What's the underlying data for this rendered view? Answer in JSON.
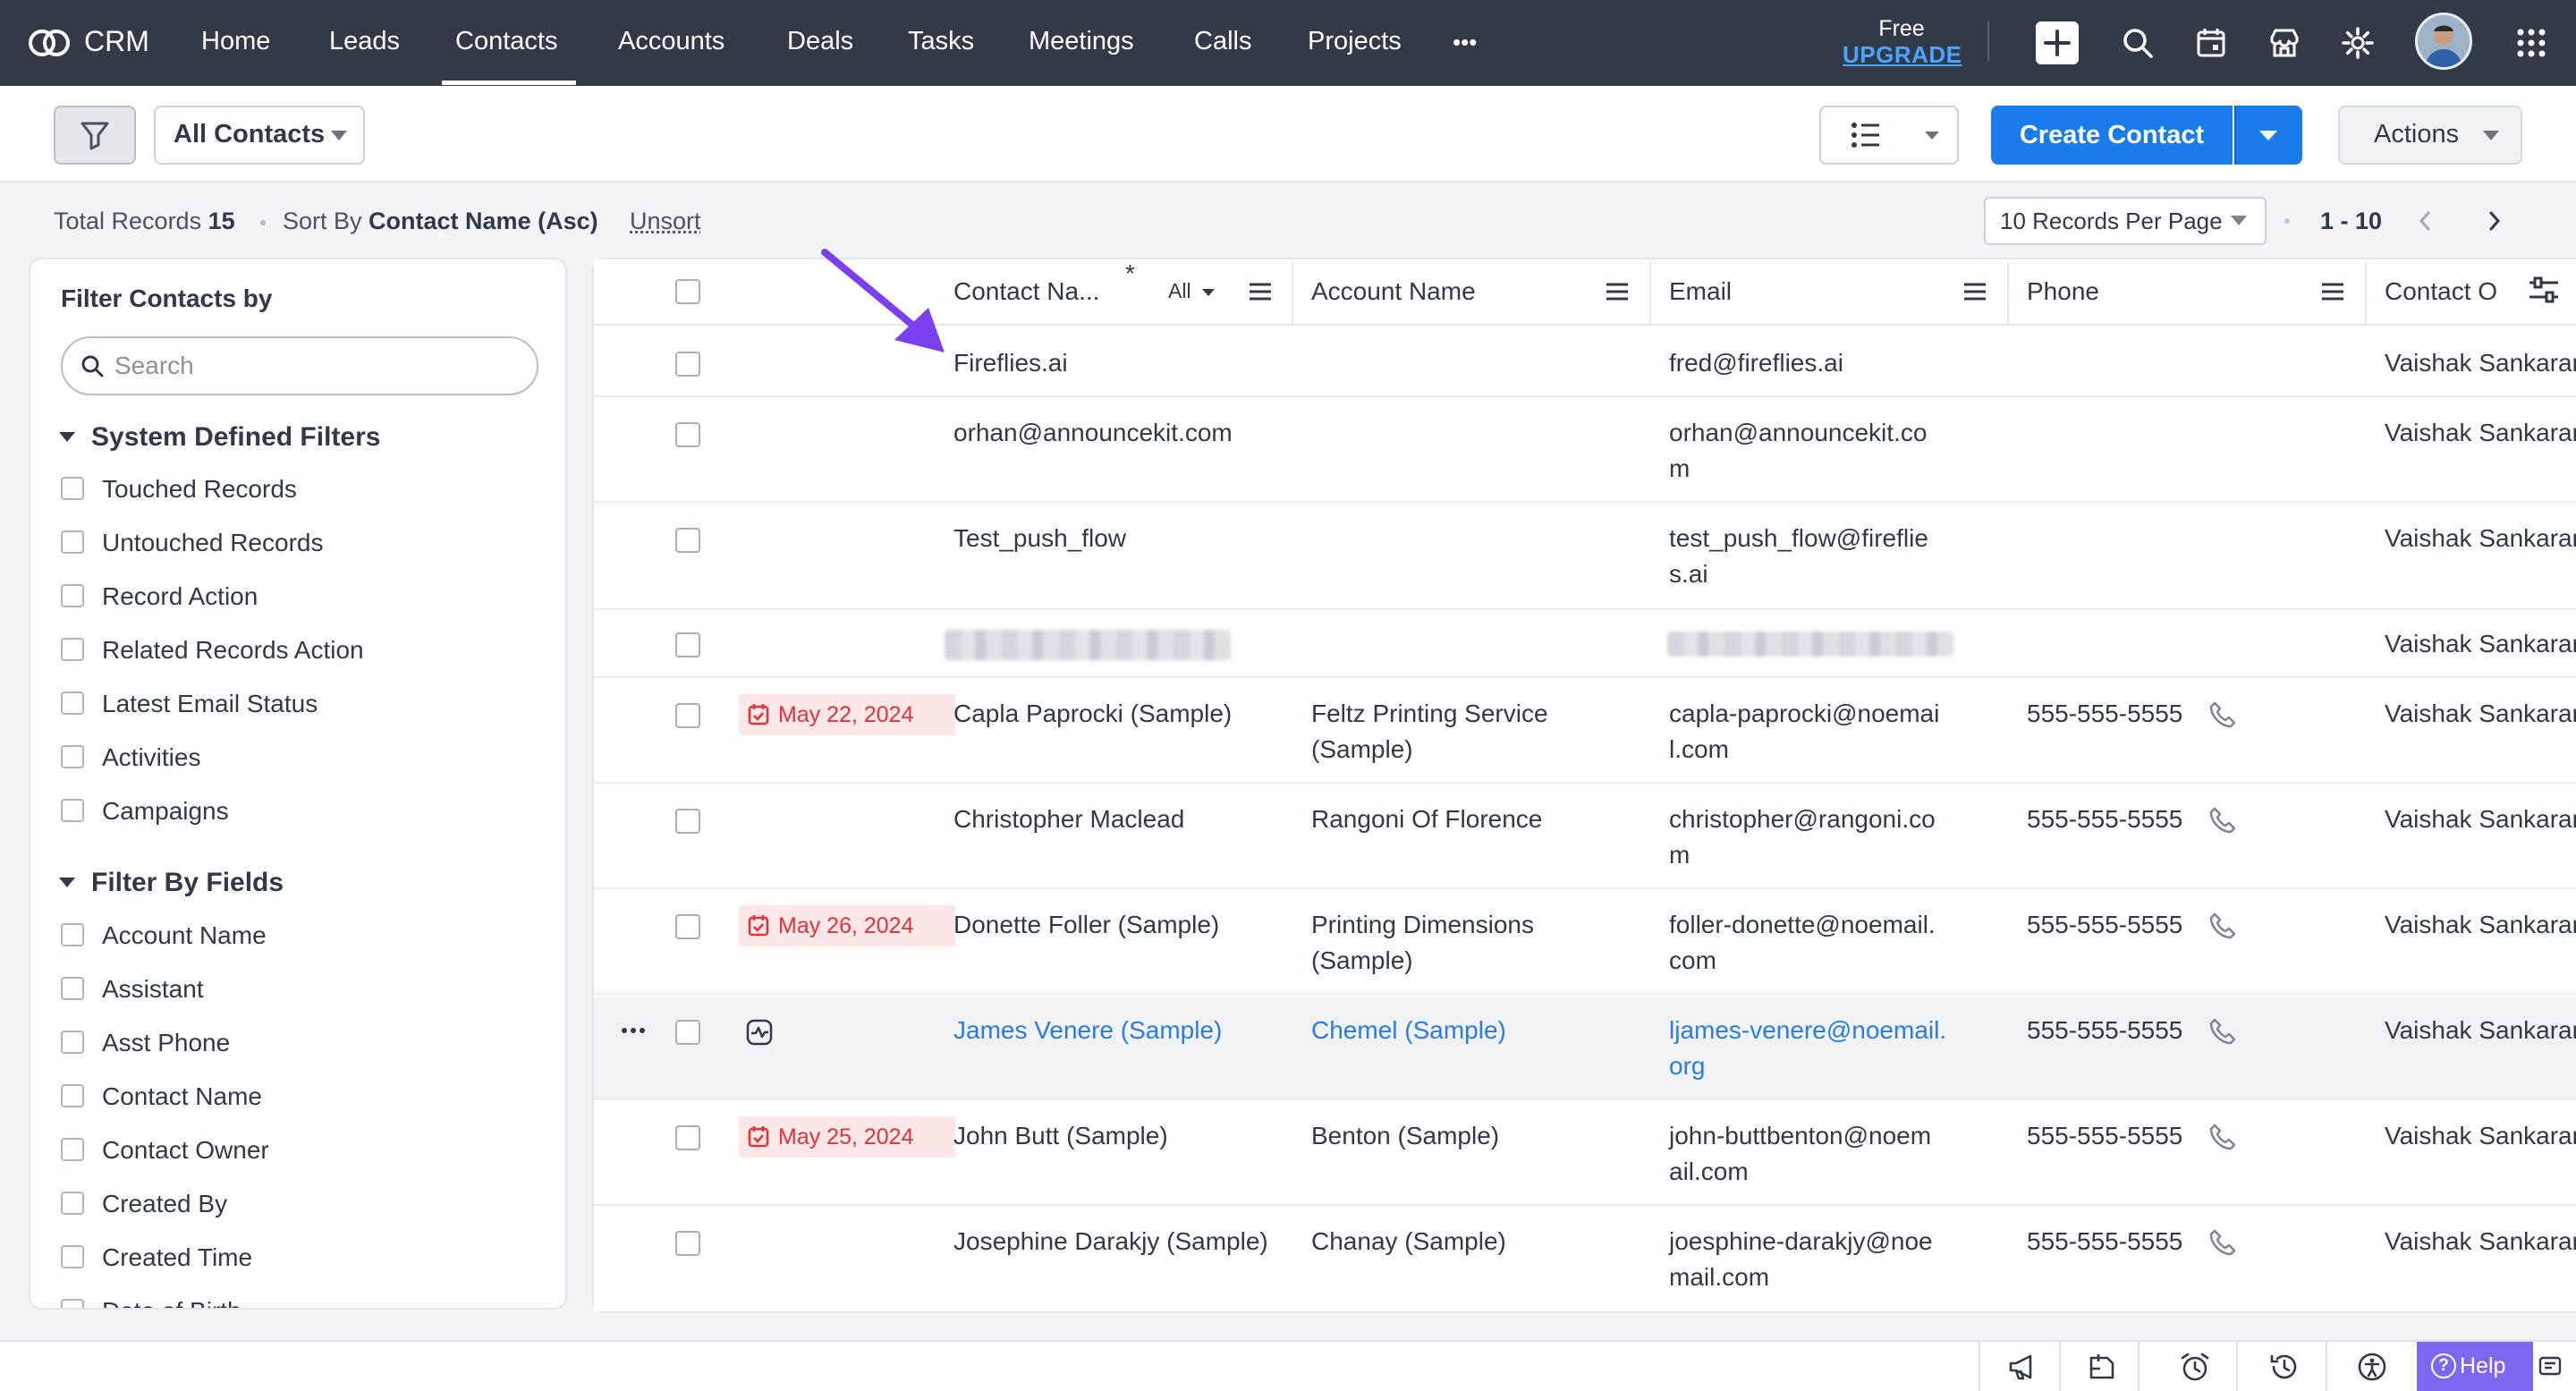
{
  "nav": {
    "app_name": "CRM",
    "items": [
      "Home",
      "Leads",
      "Contacts",
      "Accounts",
      "Deals",
      "Tasks",
      "Meetings",
      "Calls",
      "Projects"
    ],
    "active": "Contacts",
    "more": "•••",
    "free_label": "Free",
    "upgrade_label": "UPGRADE"
  },
  "toolbar": {
    "view_label": "All Contacts",
    "create_label": "Create Contact",
    "actions_label": "Actions"
  },
  "records": {
    "total_label": "Total Records",
    "total_value": "15",
    "sort_label": "Sort By",
    "sort_value": "Contact Name (Asc)",
    "unsort_label": "Unsort",
    "per_page": "10 Records Per Page",
    "range": "1 - 10"
  },
  "filters": {
    "title": "Filter Contacts by",
    "search_placeholder": "Search",
    "system_title": "System Defined Filters",
    "system_items": [
      "Touched Records",
      "Untouched Records",
      "Record Action",
      "Related Records Action",
      "Latest Email Status",
      "Activities",
      "Campaigns"
    ],
    "fields_title": "Filter By Fields",
    "field_items": [
      "Account Name",
      "Assistant",
      "Asst Phone",
      "Contact Name",
      "Contact Owner",
      "Created By",
      "Created Time",
      "Date of Birth"
    ]
  },
  "table": {
    "columns": {
      "contact_name": "Contact Na...",
      "required_mark": "*",
      "all_filter": "All",
      "account_name": "Account Name",
      "email": "Email",
      "phone": "Phone",
      "owner": "Contact O"
    },
    "rows": [
      {
        "date": "",
        "name": "Fireflies.ai",
        "account": "",
        "email": "fred@fireflies.ai",
        "phone": "",
        "owner": "Vaishak Sankaran"
      },
      {
        "date": "",
        "name": "orhan@announcekit.com",
        "account": "",
        "email": "orhan@announcekit.co\nm",
        "phone": "",
        "owner": "Vaishak Sankaran"
      },
      {
        "date": "",
        "name": "Test_push_flow",
        "account": "",
        "email": "test_push_flow@fireflie\ns.ai",
        "phone": "",
        "owner": "Vaishak Sankaran"
      },
      {
        "date": "",
        "name": "",
        "account": "",
        "email": "",
        "phone": "",
        "owner": "Vaishak Sankaran"
      },
      {
        "date": "May 22, 2024",
        "name": "Capla Paprocki (Sample)",
        "account": "Feltz Printing Service\n(Sample)",
        "email": "capla-paprocki@noemai\nl.com",
        "phone": "555-555-5555",
        "owner": "Vaishak Sankaran"
      },
      {
        "date": "",
        "name": "Christopher Maclead",
        "account": "Rangoni Of Florence",
        "email": "christopher@rangoni.co\nm",
        "phone": "555-555-5555",
        "owner": "Vaishak Sankaran"
      },
      {
        "date": "May 26, 2024",
        "name": "Donette Foller (Sample)",
        "account": "Printing Dimensions\n(Sample)",
        "email": "foller-donette@noemail.\ncom",
        "phone": "555-555-5555",
        "owner": "Vaishak Sankaran"
      },
      {
        "date": "",
        "name": "James Venere (Sample)",
        "account": "Chemel (Sample)",
        "email": "ljames-venere@noemail.\norg",
        "phone": "555-555-5555",
        "owner": "Vaishak Sankaran"
      },
      {
        "date": "May 25, 2024",
        "name": "John Butt (Sample)",
        "account": "Benton (Sample)",
        "email": "john-buttbenton@noem\nail.com",
        "phone": "555-555-5555",
        "owner": "Vaishak Sankaran"
      },
      {
        "date": "",
        "name": "Josephine Darakjy (Sample)",
        "account": "Chanay (Sample)",
        "email": "joesphine-darakjy@noe\nmail.com",
        "phone": "555-555-5555",
        "owner": "Vaishak Sankaran"
      }
    ]
  },
  "bottom_bar": {
    "help_label": "Help"
  },
  "colors": {
    "nav_bg": "#333a47",
    "primary": "#1a7bea",
    "link": "#2a7be4",
    "annotation_arrow": "#7b3ff2",
    "date_badge": "#e3323a",
    "help_bg": "#7b68ee"
  }
}
